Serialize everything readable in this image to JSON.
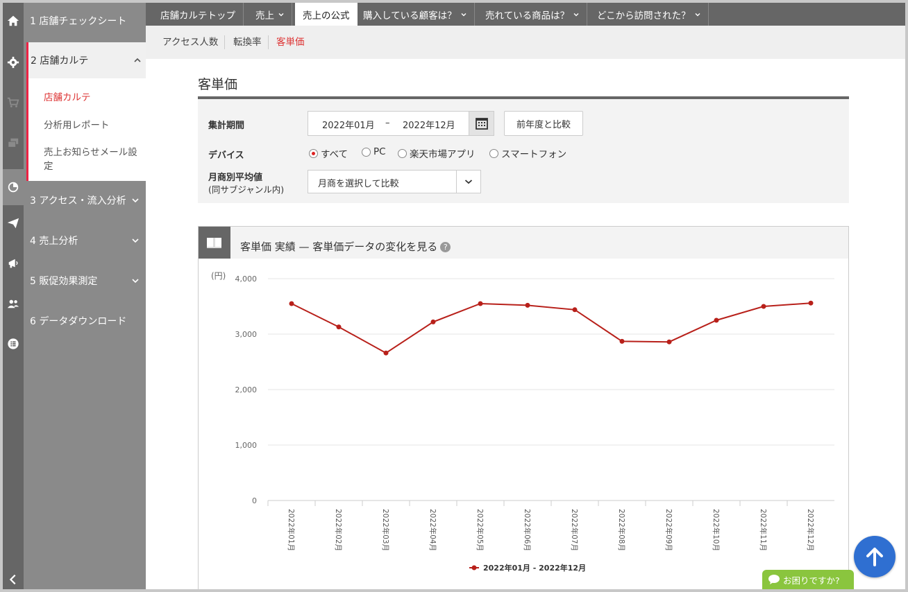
{
  "nav": {
    "items": [
      {
        "label": "1 店舗チェックシート"
      },
      {
        "label": "2 店舗カルテ"
      },
      {
        "label": "3 アクセス・流入分析"
      },
      {
        "label": "4 売上分析"
      },
      {
        "label": "5 販促効果測定"
      },
      {
        "label": "6 データダウンロード"
      }
    ],
    "subitems": [
      {
        "label": "店舗カルテ"
      },
      {
        "label": "分析用レポート"
      },
      {
        "label": "売上お知らせメール設定"
      }
    ]
  },
  "tabs": [
    {
      "label": "店舗カルテトップ"
    },
    {
      "label": "売上"
    },
    {
      "label": "売上の公式"
    },
    {
      "label": "購入している顧客は？"
    },
    {
      "label": "売れている商品は？"
    },
    {
      "label": "どこから訪問された？"
    }
  ],
  "subtabs": [
    {
      "label": "アクセス人数"
    },
    {
      "label": "転換率"
    },
    {
      "label": "客単価"
    }
  ],
  "page": {
    "title": "客単価"
  },
  "filters": {
    "period_label": "集計期間",
    "start": "2022年01月",
    "sep": "–",
    "end": "2022年12月",
    "compare_button": "前年度と比較",
    "device_label": "デバイス",
    "devices": [
      "すべて",
      "PC",
      "楽天市場アプリ",
      "スマートフォン"
    ],
    "avg_label": "月商別平均値",
    "avg_sub": "(同サブジャンル内)",
    "avg_select": "月商を選択して比較"
  },
  "panel": {
    "title": "客単価 実績 — 客単価データの変化を見る",
    "help": "?"
  },
  "chart_data": {
    "type": "line",
    "ylabel": "(円)",
    "ylim": [
      0,
      4000
    ],
    "yticks": [
      "0",
      "1,000",
      "2,000",
      "3,000",
      "4,000"
    ],
    "categories": [
      "2022年01月",
      "2022年02月",
      "2022年03月",
      "2022年04月",
      "2022年05月",
      "2022年06月",
      "2022年07月",
      "2022年08月",
      "2022年09月",
      "2022年10月",
      "2022年11月",
      "2022年12月"
    ],
    "series": [
      {
        "name": "2022年01月 - 2022年12月",
        "color": "#b8201a",
        "values": [
          3550,
          3130,
          2660,
          3220,
          3550,
          3520,
          3440,
          2870,
          2860,
          3250,
          3500,
          3560
        ]
      }
    ],
    "grid": true,
    "legend": "bottom"
  },
  "help_chat": {
    "label": "お困りですか?"
  }
}
